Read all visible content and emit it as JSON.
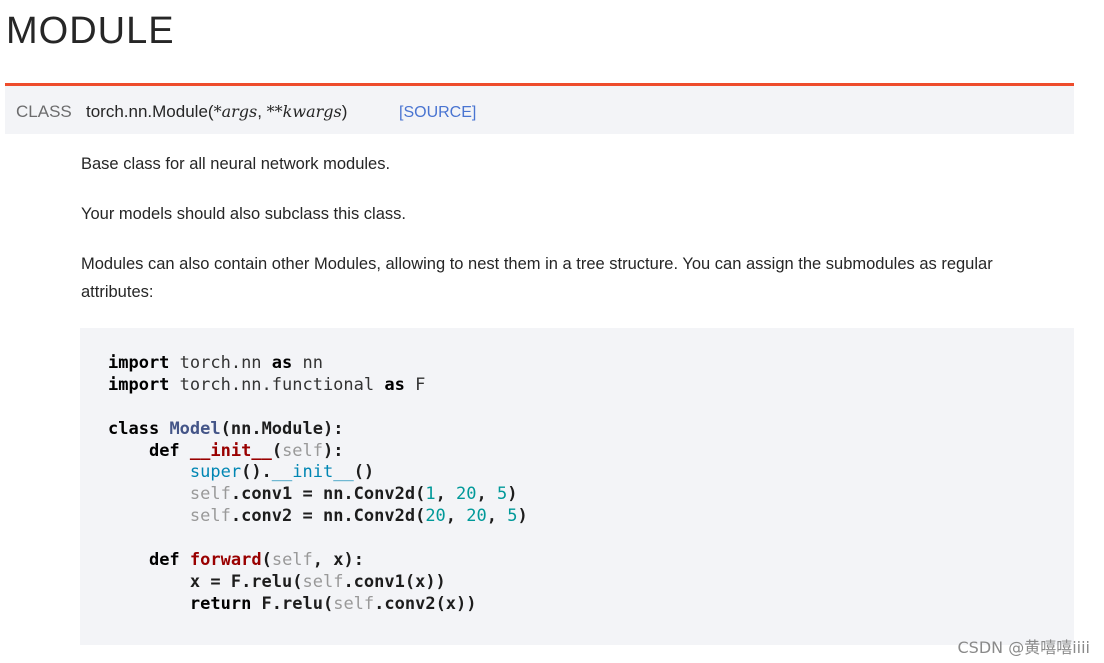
{
  "page_title": "MODULE",
  "signature": {
    "keyword": "CLASS",
    "name": "torch.nn.Module",
    "open_paren": "(",
    "arg1": "*args",
    "sep": ", ",
    "arg2": "**kwargs",
    "close_paren": ")",
    "source_link": "[SOURCE]"
  },
  "paragraphs": [
    "Base class for all neural network modules.",
    "Your models should also subclass this class.",
    "Modules can also contain other Modules, allowing to nest them in a tree structure. You can assign the submodules as regular attributes:"
  ],
  "code": {
    "l1": {
      "a": "import",
      "b": " torch.nn ",
      "c": "as",
      "d": " nn"
    },
    "l2": {
      "a": "import",
      "b": " torch.nn.functional ",
      "c": "as",
      "d": " F"
    },
    "l4": {
      "a": "class",
      "b": " ",
      "c": "Model",
      "d": "(nn.Module):"
    },
    "l5": {
      "a": "    ",
      "b": "def",
      "c": " ",
      "d": "__init__",
      "e": "(",
      "f": "self",
      "g": "):"
    },
    "l6": {
      "a": "        ",
      "b": "super",
      "c": "().",
      "d": "__init__",
      "e": "()"
    },
    "l7": {
      "a": "        ",
      "b": "self",
      "c": ".conv1 = nn.Conv2d(",
      "d": "1",
      "e": ", ",
      "f": "20",
      "g": ", ",
      "h": "5",
      "i": ")"
    },
    "l8": {
      "a": "        ",
      "b": "self",
      "c": ".conv2 = nn.Conv2d(",
      "d": "20",
      "e": ", ",
      "f": "20",
      "g": ", ",
      "h": "5",
      "i": ")"
    },
    "l10": {
      "a": "    ",
      "b": "def",
      "c": " ",
      "d": "forward",
      "e": "(",
      "f": "self",
      "g": ", x):"
    },
    "l11": {
      "a": "        ",
      "b": "x = F.relu(",
      "c": "self",
      "d": ".conv1(x))"
    },
    "l12": {
      "a": "        ",
      "b": "return",
      "c": " F.relu(",
      "d": "self",
      "e": ".conv2(x))"
    }
  },
  "watermark": "CSDN @黄嘻嘻iiii",
  "colors": {
    "accent": "#ee4c2c",
    "link": "#4974d1",
    "panel_bg": "#f3f4f7"
  }
}
